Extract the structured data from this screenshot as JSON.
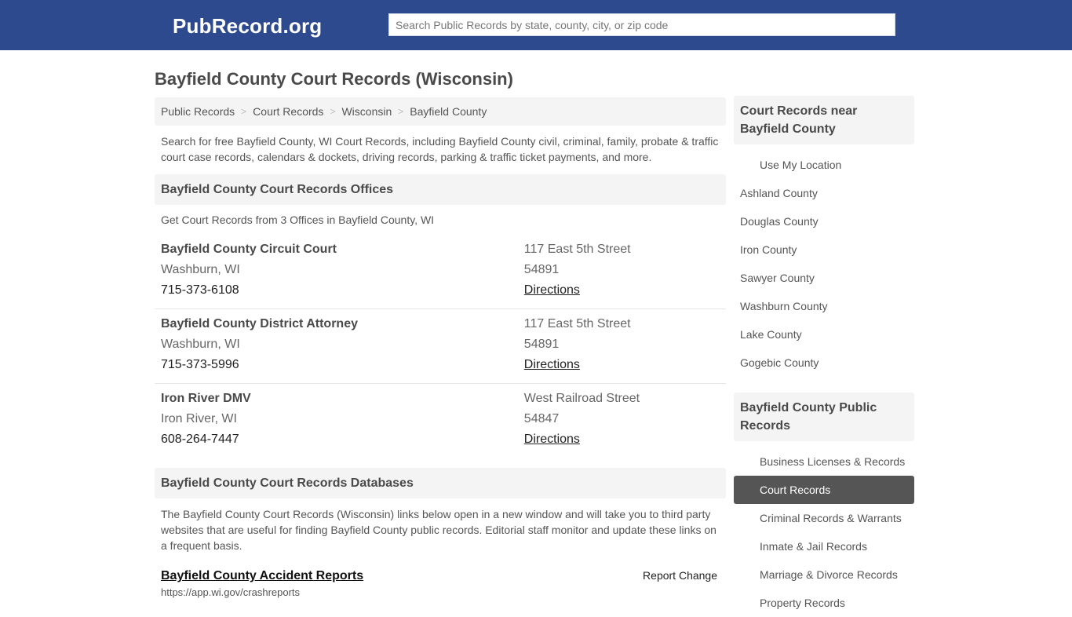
{
  "header": {
    "logo": "PubRecord.org",
    "search_placeholder": "Search Public Records by state, county, city, or zip code",
    "brand_color": "#2e4a8f"
  },
  "page": {
    "title": "Bayfield County Court Records (Wisconsin)",
    "breadcrumb": [
      "Public Records",
      "Court Records",
      "Wisconsin",
      "Bayfield County"
    ],
    "breadcrumb_separator": ">",
    "intro": "Search for free Bayfield County, WI Court Records, including Bayfield County civil, criminal, family, probate & traffic court case records, calendars & dockets, driving records, parking & traffic ticket payments, and more."
  },
  "offices": {
    "heading": "Bayfield County Court Records Offices",
    "subtitle": "Get Court Records from 3 Offices in Bayfield County, WI",
    "items": [
      {
        "name": "Bayfield County Circuit Court",
        "city": "Washburn, WI",
        "phone": "715-373-6108",
        "address": "117 East 5th Street",
        "zip": "54891",
        "directions": "Directions"
      },
      {
        "name": "Bayfield County District Attorney",
        "city": "Washburn, WI",
        "phone": "715-373-5996",
        "address": "117 East 5th Street",
        "zip": "54891",
        "directions": "Directions"
      },
      {
        "name": "Iron River DMV",
        "city": "Iron River, WI",
        "phone": "608-264-7447",
        "address": "West Railroad Street",
        "zip": "54847",
        "directions": "Directions"
      }
    ]
  },
  "databases": {
    "heading": "Bayfield County Court Records Databases",
    "intro": "The Bayfield County Court Records (Wisconsin) links below open in a new window and will take you to third party websites that are useful for finding Bayfield County public records. Editorial staff monitor and update these links on a frequent basis.",
    "items": [
      {
        "title": "Bayfield County Accident Reports",
        "report_change": "Report Change",
        "url": "https://app.wi.gov/crashreports"
      }
    ]
  },
  "sidebar": {
    "near": {
      "heading": "Court Records near Bayfield County",
      "use_location": "Use My Location",
      "counties": [
        "Ashland County",
        "Douglas County",
        "Iron County",
        "Sawyer County",
        "Washburn County",
        "Lake County",
        "Gogebic County"
      ]
    },
    "public": {
      "heading": "Bayfield County Public Records",
      "items": [
        {
          "label": "Business Licenses & Records",
          "active": false
        },
        {
          "label": "Court Records",
          "active": true
        },
        {
          "label": "Criminal Records & Warrants",
          "active": false
        },
        {
          "label": "Inmate & Jail Records",
          "active": false
        },
        {
          "label": "Marriage & Divorce Records",
          "active": false
        },
        {
          "label": "Property Records",
          "active": false
        }
      ]
    }
  }
}
